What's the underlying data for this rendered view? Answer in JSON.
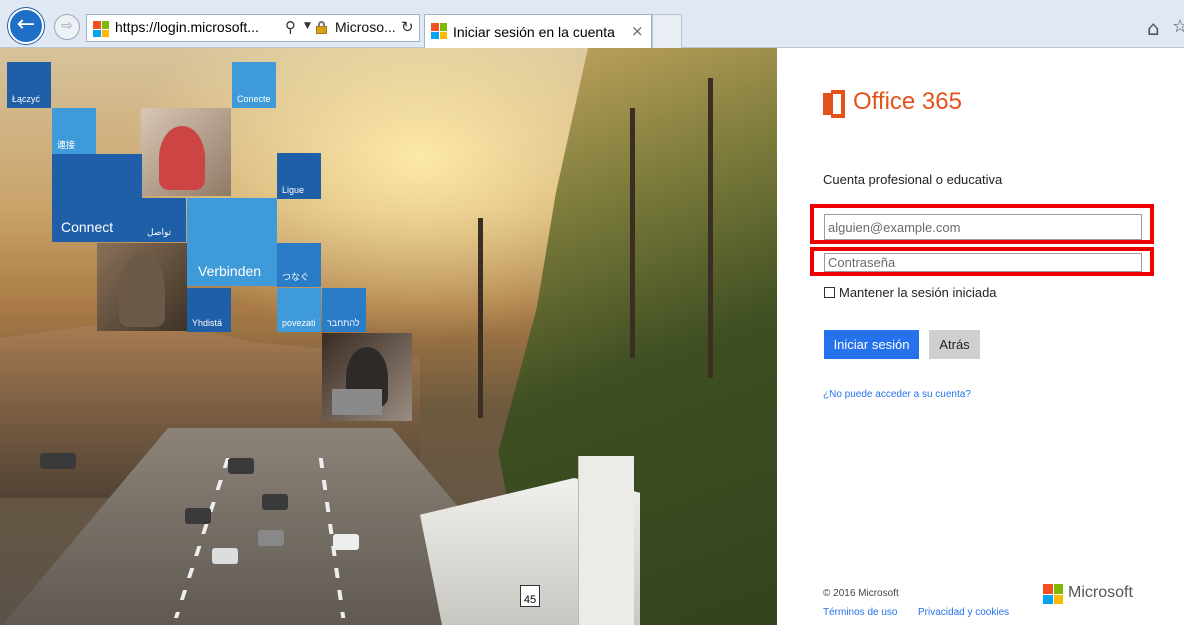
{
  "browser": {
    "url": "https://login.microsoft...",
    "site_identity": "Microso...",
    "tab_title": "Iniciar sesión en la cuenta",
    "tab_close": "×",
    "back": "←",
    "forward": "⇨",
    "search_glyph": "⚲",
    "refresh_glyph": "↻",
    "home_glyph": "⌂",
    "fav_glyph": "☆"
  },
  "hero": {
    "tiles": [
      "Łączyć",
      "Conecte",
      "連接",
      "Ligue",
      "Connect",
      "تواصل",
      "Verbinden",
      "つなぐ",
      "Yhdistä",
      "povezati",
      "להתחבר"
    ],
    "sign_number": "45"
  },
  "signin": {
    "product": "Office 365",
    "account_label": "Cuenta profesional o educativa",
    "email_placeholder": "alguien@example.com",
    "password_placeholder": "Contraseña",
    "keep_signed_in": "Mantener la sesión iniciada",
    "submit": "Iniciar sesión",
    "back": "Atrás",
    "help_link": "¿No puede acceder a su cuenta?"
  },
  "footer": {
    "copyright": "© 2016 Microsoft",
    "terms": "Términos de uso",
    "privacy": "Privacidad y cookies",
    "brand": "Microsoft"
  },
  "colors": {
    "office_orange": "#e4521b",
    "signin_blue": "#2672ec",
    "highlight_red": "#ee0000",
    "ms_red": "#f25022",
    "ms_green": "#7fba00",
    "ms_blue": "#00a4ef",
    "ms_yellow": "#ffb900"
  }
}
